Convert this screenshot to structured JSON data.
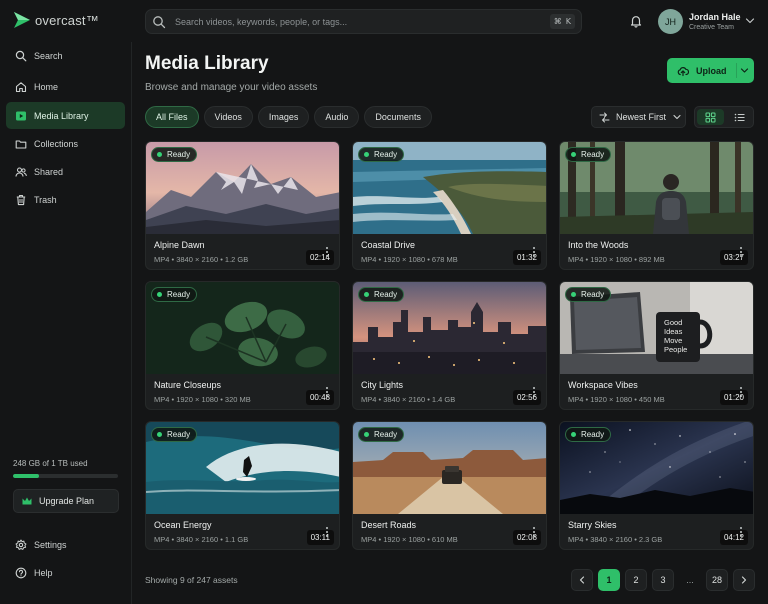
{
  "app": {
    "name": "overcast™"
  },
  "search": {
    "placeholder": "Search videos, keywords, people, or tags...",
    "shortcut_key": "⌘",
    "shortcut_letter": "K"
  },
  "user": {
    "initials": "JH",
    "name": "Jordan Hale",
    "team": "Creative Team"
  },
  "sidebar": {
    "items": [
      {
        "label": "Search",
        "icon": "search-icon"
      },
      {
        "label": "Home",
        "icon": "home-icon"
      },
      {
        "label": "Media Library",
        "icon": "media-icon",
        "active": true
      },
      {
        "label": "Collections",
        "icon": "folder-icon"
      },
      {
        "label": "Shared",
        "icon": "users-icon"
      },
      {
        "label": "Trash",
        "icon": "trash-icon"
      }
    ],
    "storage": {
      "text": "248 GB of 1 TB used",
      "fraction": 0.248
    },
    "upgrade_label": "Upgrade Plan",
    "settings_label": "Settings",
    "help_label": "Help"
  },
  "header": {
    "title": "Media Library",
    "subtitle": "Browse and manage your video assets",
    "upload_label": "Upload"
  },
  "filters": [
    "All Files",
    "Videos",
    "Images",
    "Audio",
    "Documents"
  ],
  "active_filter": "All Files",
  "sort": {
    "label": "Newest First"
  },
  "cards": [
    {
      "status": "Ready",
      "duration": "02:14",
      "title": "Alpine Dawn",
      "meta": "MP4 • 3840 × 2160 • 1.2 GB"
    },
    {
      "status": "Ready",
      "duration": "01:32",
      "title": "Coastal Drive",
      "meta": "MP4 • 1920 × 1080 • 678 MB"
    },
    {
      "status": "Ready",
      "duration": "03:27",
      "title": "Into the Woods",
      "meta": "MP4 • 1920 × 1080 • 892 MB"
    },
    {
      "status": "Ready",
      "duration": "00:48",
      "title": "Nature Closeups",
      "meta": "MP4 • 1920 × 1080 • 320 MB"
    },
    {
      "status": "Ready",
      "duration": "02:56",
      "title": "City Lights",
      "meta": "MP4 • 3840 × 2160 • 1.4 GB"
    },
    {
      "status": "Ready",
      "duration": "01:20",
      "title": "Workspace Vibes",
      "meta": "MP4 • 1920 × 1080 • 450 MB",
      "mug_text": [
        "Good",
        "Ideas",
        "Move",
        "People"
      ]
    },
    {
      "status": "Ready",
      "duration": "03:11",
      "title": "Ocean Energy",
      "meta": "MP4 • 3840 × 2160 • 1.1 GB"
    },
    {
      "status": "Ready",
      "duration": "02:08",
      "title": "Desert Roads",
      "meta": "MP4 • 1920 × 1080 • 610 MB"
    },
    {
      "status": "Ready",
      "duration": "04:12",
      "title": "Starry Skies",
      "meta": "MP4 • 3840 × 2160 • 2.3 GB"
    }
  ],
  "footer": {
    "showing": "Showing 9 of 247 assets",
    "pages": [
      "1",
      "2",
      "3",
      "...",
      "28"
    ],
    "current_page": "1"
  },
  "colors": {
    "accent": "#2fbf69",
    "active_bg": "#1c3a27",
    "background": "#141516"
  }
}
